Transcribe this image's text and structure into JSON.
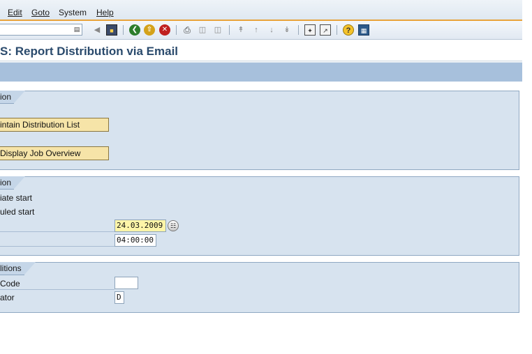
{
  "menu": {
    "items": [
      {
        "label": "Edit"
      },
      {
        "label": "Goto"
      },
      {
        "label": "System"
      },
      {
        "label": "Help"
      }
    ]
  },
  "toolbar": {
    "command_value": "",
    "icons": [
      "list-icon",
      "back-arrow-icon",
      "save-icon",
      "green-back-icon",
      "exit-icon",
      "cancel-icon",
      "print-icon",
      "find-icon",
      "find-next-icon",
      "first-page-icon",
      "previous-page-icon",
      "next-page-icon",
      "last-page-icon",
      "create-session-icon",
      "shortcut-icon",
      "help-icon",
      "layout-menu-icon"
    ]
  },
  "title": "S: Report Distribution via Email",
  "groups": {
    "group1": {
      "title": "ion",
      "buttons": [
        "intain Distribution List",
        "Display Job Overview"
      ]
    },
    "group2": {
      "title": "ion",
      "labels": [
        "iate start",
        "uled start",
        "",
        ""
      ],
      "date_value": "24.03.2009",
      "time_value": "04:00:00"
    },
    "group3": {
      "title": "litions",
      "labels": [
        "Code",
        "ator"
      ],
      "code_value": "",
      "indicator_value": "D"
    }
  },
  "colors": {
    "title_text": "#2a4a6c",
    "group_background": "#d7e3ef",
    "app_toolbar": "#a7c0dc",
    "button_background": "#f6e4a8",
    "required_field": "#fdf5a8",
    "menu_accent": "#e8a33a"
  }
}
